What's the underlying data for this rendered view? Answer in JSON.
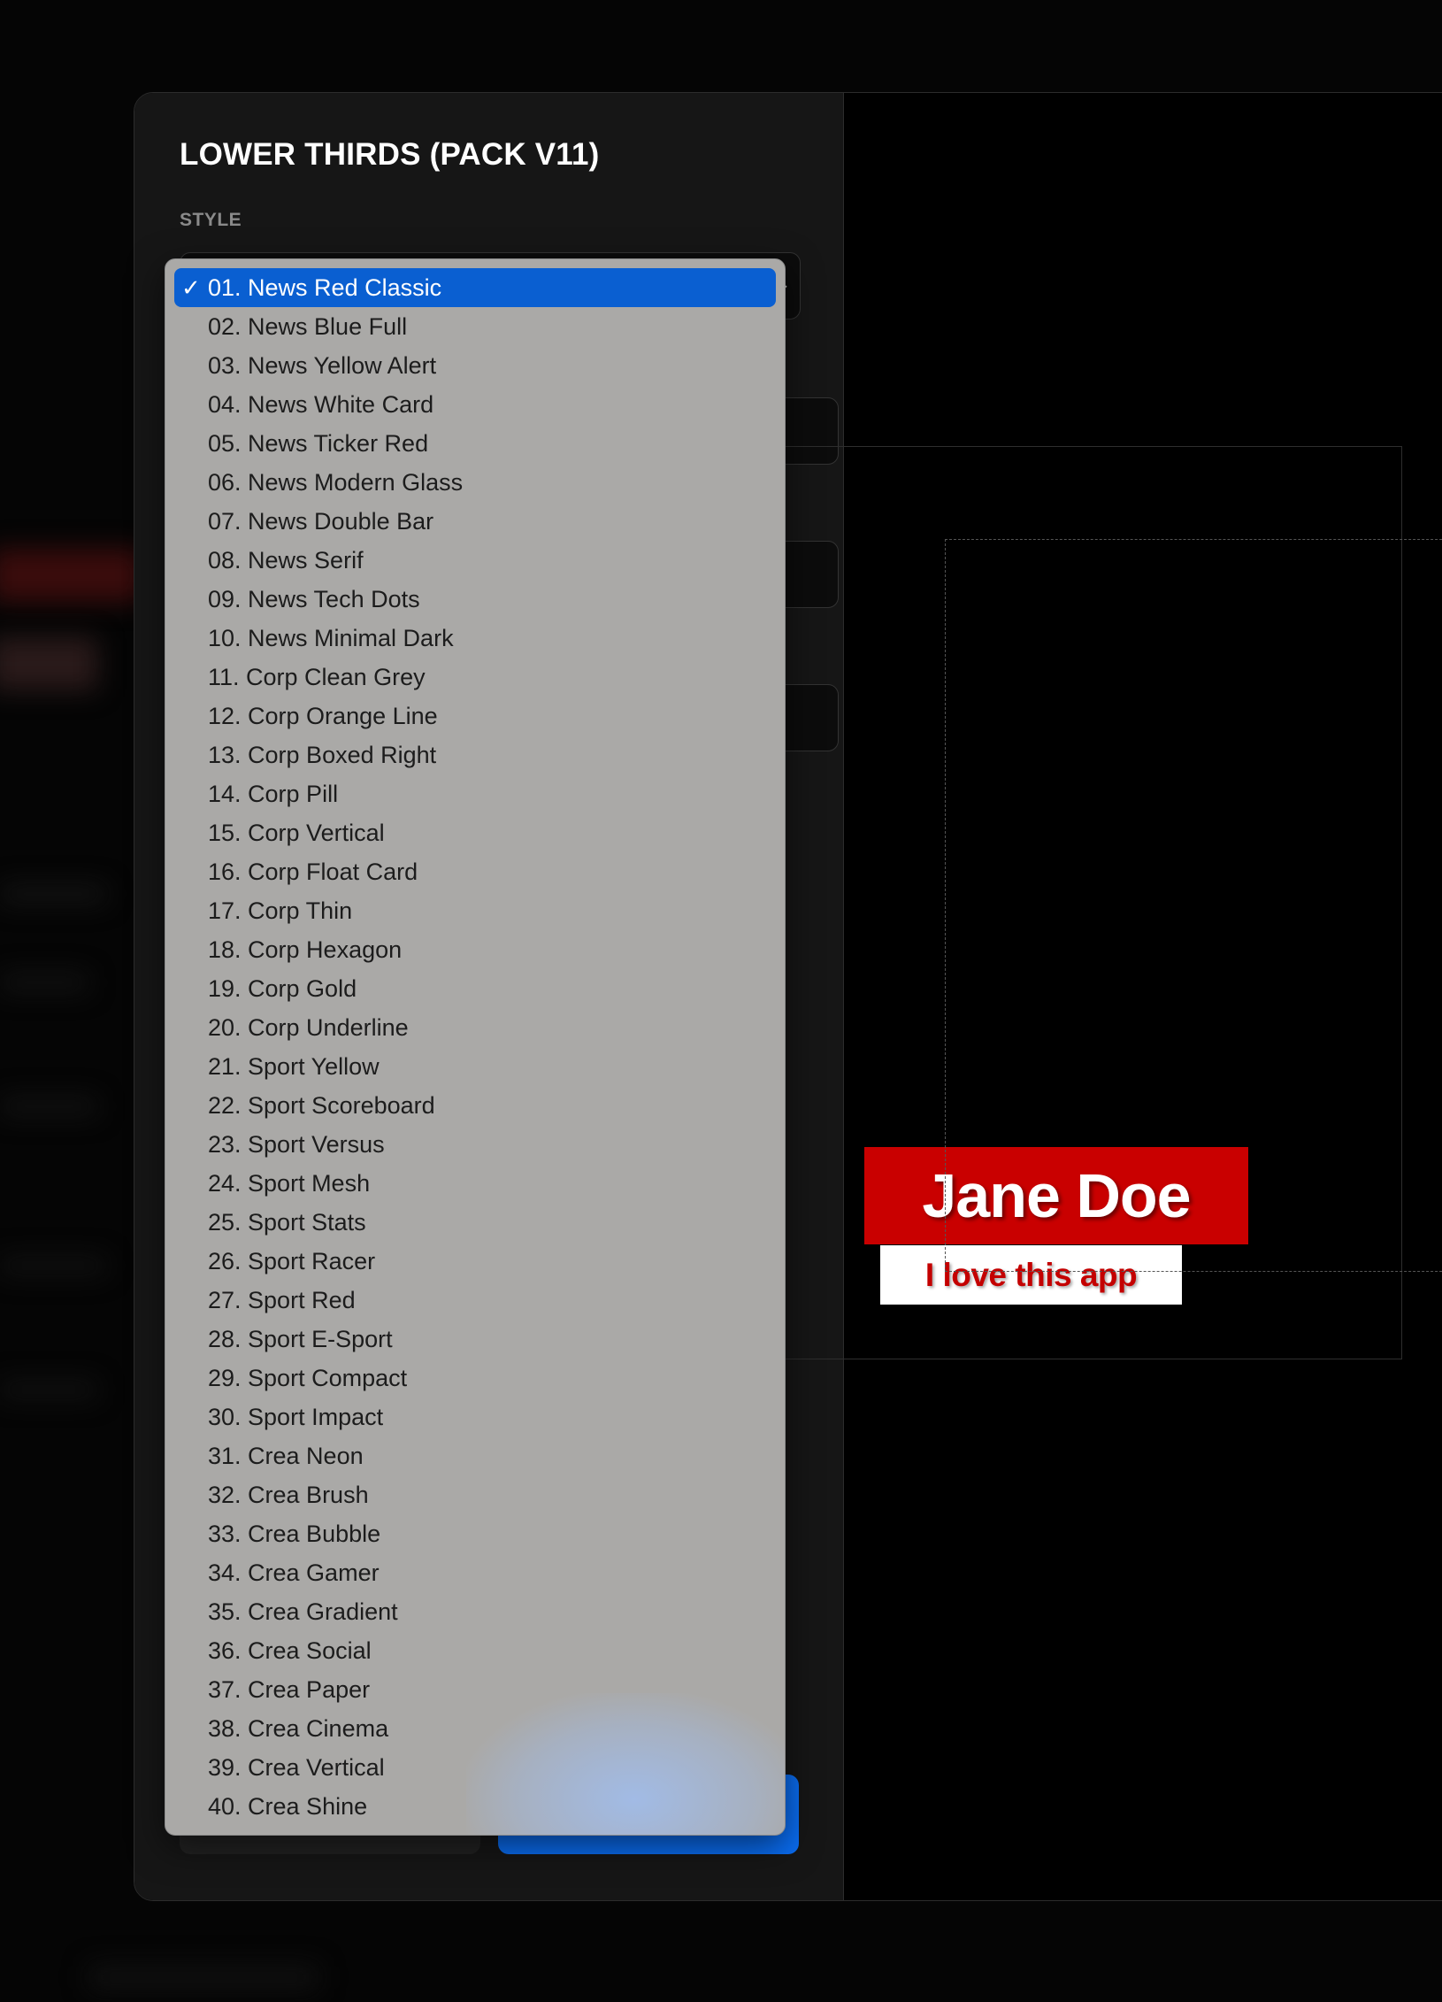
{
  "panel": {
    "title": "LOWER THIRDS (PACK V11)",
    "style_label": "STYLE",
    "check_glyph": "✓",
    "chevron_glyph": "⌄"
  },
  "dropdown": {
    "selected_index": 0,
    "options": [
      "01. News Red Classic",
      "02. News Blue Full",
      "03. News Yellow Alert",
      "04. News White Card",
      "05. News Ticker Red",
      "06. News Modern Glass",
      "07. News Double Bar",
      "08. News Serif",
      "09. News Tech Dots",
      "10. News Minimal Dark",
      "11. Corp Clean Grey",
      "12. Corp Orange Line",
      "13. Corp Boxed Right",
      "14. Corp Pill",
      "15. Corp Vertical",
      "16. Corp Float Card",
      "17. Corp Thin",
      "18. Corp Hexagon",
      "19. Corp Gold",
      "20. Corp Underline",
      "21. Sport Yellow",
      "22. Sport Scoreboard",
      "23. Sport Versus",
      "24. Sport Mesh",
      "25. Sport Stats",
      "26. Sport Racer",
      "27. Sport Red",
      "28. Sport E-Sport",
      "29. Sport Compact",
      "30. Sport Impact",
      "31. Crea Neon",
      "32. Crea Brush",
      "33. Crea Bubble",
      "34. Crea Gamer",
      "35. Crea Gradient",
      "36. Crea Social",
      "37. Crea Paper",
      "38. Crea Cinema",
      "39. Crea Vertical",
      "40. Crea Shine"
    ]
  },
  "preview": {
    "name": "Jane Doe",
    "subtitle": "I love this app"
  },
  "colors": {
    "accent": "#0a6cf0",
    "selected_option": "#0a5fd1",
    "name_bar": "#c90000",
    "subtitle_text": "#c40000"
  }
}
